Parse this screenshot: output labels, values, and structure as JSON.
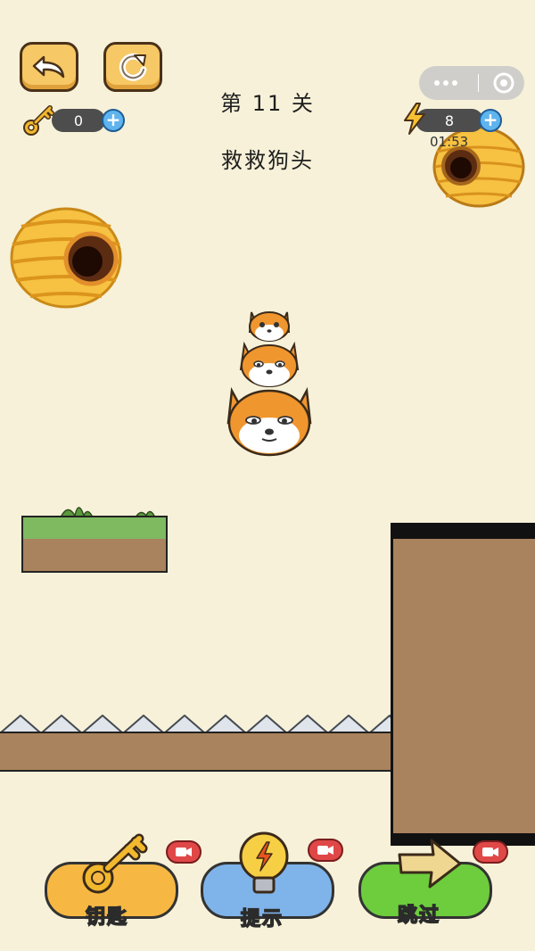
{
  "header": {
    "level_title": "第 11 关",
    "level_name": "救救狗头"
  },
  "counters": {
    "keys": "0",
    "energy": "8",
    "timer": "01:53"
  },
  "bottom_buttons": {
    "key_label": "钥匙",
    "hint_label": "提示",
    "skip_label": "跳过"
  },
  "icons": {
    "back": "back-arrow-icon",
    "restart": "restart-icon",
    "key": "key-icon",
    "energy": "lightning-icon",
    "plus": "plus-icon",
    "capsule_more": "more-dots-icon",
    "capsule_close": "target-circle-icon",
    "video": "video-camera-icon",
    "hint": "lightbulb-icon",
    "skip": "arrow-right-icon"
  },
  "colors": {
    "background": "#f6f1d8",
    "button_orange": "#f7b843",
    "button_blue": "#7fb4ea",
    "button_green": "#6dcd3d",
    "dirt": "#a9825e",
    "grass": "#7fb960"
  }
}
